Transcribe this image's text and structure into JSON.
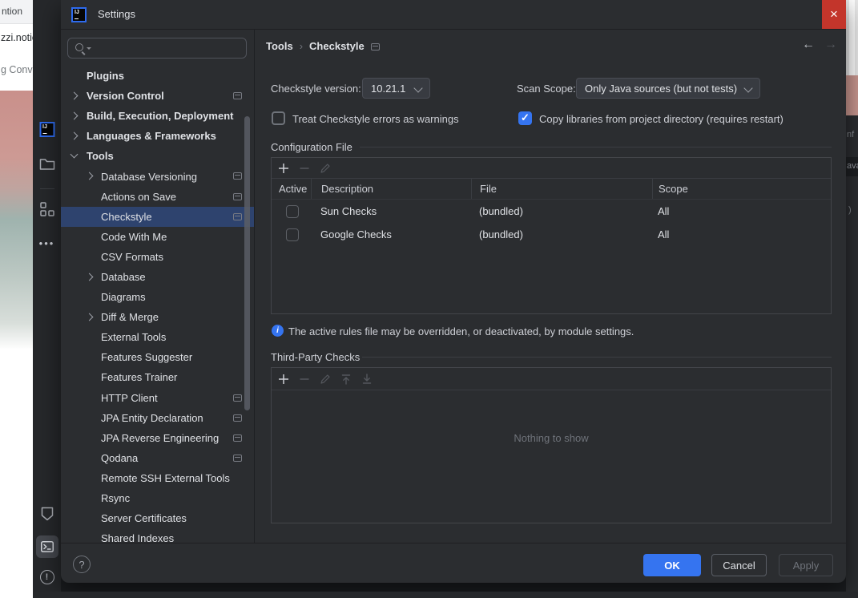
{
  "window": {
    "title": "Settings"
  },
  "background": {
    "browser": {
      "tab_text": "ntion",
      "url_text": "zzi.notion.sit",
      "page_text": "g Conventio"
    },
    "editor_fragments": {
      "top": "nf",
      "tab": "ava",
      "code": ")"
    },
    "ide_strip_icons": [
      "intellij-logo",
      "project-folder",
      "structure",
      "more",
      "services-shield",
      "terminal",
      "problems"
    ]
  },
  "nav": {
    "back_icon": "arrow-left",
    "forward_icon": "arrow-right",
    "back_glyph": "←",
    "forward_glyph": "→"
  },
  "sidebar": {
    "search_placeholder": "",
    "items": [
      {
        "label": "Plugins",
        "level": 0,
        "chevron": null,
        "icon": false,
        "selected": false
      },
      {
        "label": "Version Control",
        "level": 0,
        "chevron": "collapsed",
        "icon": true,
        "selected": false
      },
      {
        "label": "Build, Execution, Deployment",
        "level": 0,
        "chevron": "collapsed",
        "icon": false,
        "selected": false
      },
      {
        "label": "Languages & Frameworks",
        "level": 0,
        "chevron": "collapsed",
        "icon": false,
        "selected": false
      },
      {
        "label": "Tools",
        "level": 0,
        "chevron": "expanded",
        "icon": false,
        "selected": false
      },
      {
        "label": "Database Versioning",
        "level": 1,
        "chevron": "collapsed",
        "icon": true,
        "selected": false
      },
      {
        "label": "Actions on Save",
        "level": 1,
        "chevron": null,
        "icon": true,
        "selected": false
      },
      {
        "label": "Checkstyle",
        "level": 1,
        "chevron": null,
        "icon": true,
        "selected": true
      },
      {
        "label": "Code With Me",
        "level": 1,
        "chevron": null,
        "icon": false,
        "selected": false
      },
      {
        "label": "CSV Formats",
        "level": 1,
        "chevron": null,
        "icon": false,
        "selected": false
      },
      {
        "label": "Database",
        "level": 1,
        "chevron": "collapsed",
        "icon": false,
        "selected": false
      },
      {
        "label": "Diagrams",
        "level": 1,
        "chevron": null,
        "icon": false,
        "selected": false
      },
      {
        "label": "Diff & Merge",
        "level": 1,
        "chevron": "collapsed",
        "icon": false,
        "selected": false
      },
      {
        "label": "External Tools",
        "level": 1,
        "chevron": null,
        "icon": false,
        "selected": false
      },
      {
        "label": "Features Suggester",
        "level": 1,
        "chevron": null,
        "icon": false,
        "selected": false
      },
      {
        "label": "Features Trainer",
        "level": 1,
        "chevron": null,
        "icon": false,
        "selected": false
      },
      {
        "label": "HTTP Client",
        "level": 1,
        "chevron": null,
        "icon": true,
        "selected": false
      },
      {
        "label": "JPA Entity Declaration",
        "level": 1,
        "chevron": null,
        "icon": true,
        "selected": false
      },
      {
        "label": "JPA Reverse Engineering",
        "level": 1,
        "chevron": null,
        "icon": true,
        "selected": false
      },
      {
        "label": "Qodana",
        "level": 1,
        "chevron": null,
        "icon": true,
        "selected": false
      },
      {
        "label": "Remote SSH External Tools",
        "level": 1,
        "chevron": null,
        "icon": false,
        "selected": false
      },
      {
        "label": "Rsync",
        "level": 1,
        "chevron": null,
        "icon": false,
        "selected": false
      },
      {
        "label": "Server Certificates",
        "level": 1,
        "chevron": null,
        "icon": false,
        "selected": false
      },
      {
        "label": "Shared Indexes",
        "level": 1,
        "chevron": null,
        "icon": false,
        "selected": false
      }
    ]
  },
  "breadcrumb": {
    "parent": "Tools",
    "separator": "›",
    "current": "Checkstyle"
  },
  "content": {
    "version_label": "Checkstyle version:",
    "version_value": "10.21.1",
    "scan_scope_label": "Scan Scope:",
    "scan_scope_value": "Only Java sources (but not tests)",
    "treat_errors_label": "Treat Checkstyle errors as warnings",
    "treat_errors_checked": false,
    "copy_libraries_label": "Copy libraries from project directory (requires restart)",
    "copy_libraries_checked": true,
    "config_file": {
      "section_label": "Configuration File",
      "toolbar": [
        {
          "name": "add",
          "enabled": true
        },
        {
          "name": "remove",
          "enabled": false
        },
        {
          "name": "edit",
          "enabled": false
        }
      ],
      "columns": [
        "Active",
        "Description",
        "File",
        "Scope"
      ],
      "rows": [
        {
          "active": false,
          "description": "Sun Checks",
          "file": "(bundled)",
          "scope": "All"
        },
        {
          "active": false,
          "description": "Google Checks",
          "file": "(bundled)",
          "scope": "All"
        }
      ]
    },
    "info_text": "The active rules file may be overridden, or deactivated, by module settings.",
    "third_party": {
      "section_label": "Third-Party Checks",
      "toolbar": [
        {
          "name": "add",
          "enabled": true
        },
        {
          "name": "remove",
          "enabled": false
        },
        {
          "name": "edit",
          "enabled": false
        },
        {
          "name": "move-up",
          "enabled": false
        },
        {
          "name": "move-down",
          "enabled": false
        }
      ],
      "empty_text": "Nothing to show"
    }
  },
  "footer": {
    "ok": "OK",
    "cancel": "Cancel",
    "apply": "Apply",
    "help_icon": "question-mark"
  },
  "colors": {
    "accent": "#3574F0",
    "selection": "#2E436E",
    "close_button": "#C3352B",
    "dialog_bg": "#2B2D30",
    "border": "#43454A",
    "checkbox_checked": "#3574F0"
  }
}
